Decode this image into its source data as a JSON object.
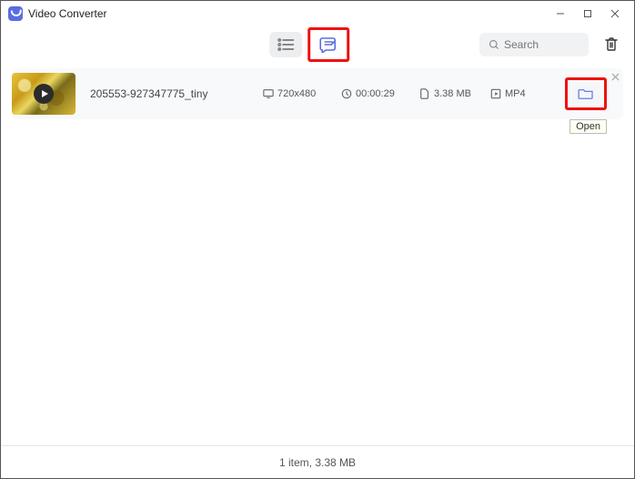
{
  "app": {
    "title": "Video Converter"
  },
  "search": {
    "placeholder": "Search"
  },
  "tooltip": {
    "open": "Open"
  },
  "items": [
    {
      "name": "205553-927347775_tiny",
      "resolution": "720x480",
      "duration": "00:00:29",
      "size": "3.38 MB",
      "format": "MP4"
    }
  ],
  "status": {
    "summary": "1 item, 3.38 MB"
  }
}
